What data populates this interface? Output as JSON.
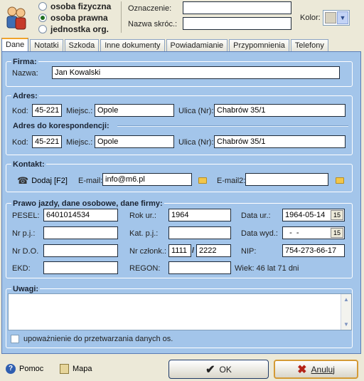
{
  "header": {
    "radio_options": [
      {
        "label": "osoba fizyczna",
        "selected": false
      },
      {
        "label": "osoba prawna",
        "selected": true
      },
      {
        "label": "jednostka org.",
        "selected": false
      }
    ],
    "oznaczenie_label": "Oznaczenie:",
    "oznaczenie_value": "",
    "nazwa_skroc_label": "Nazwa skróc.:",
    "nazwa_skroc_value": "",
    "kolor_label": "Kolor:"
  },
  "tabs": [
    "Dane",
    "Notatki",
    "Szkoda",
    "Inne dokumenty",
    "Powiadamianie",
    "Przypomnienia",
    "Telefony"
  ],
  "firma": {
    "title": "Firma:",
    "nazwa_label": "Nazwa:",
    "nazwa_value": "Jan Kowalski"
  },
  "adres": {
    "title": "Adres:",
    "kod_label": "Kod:",
    "kod_value": "45-221",
    "miejsc_label": "Miejsc.:",
    "miejsc_value": "Opole",
    "ulica_label": "Ulica (Nr):",
    "ulica_value": "Chabrów 35/1"
  },
  "adres_kor": {
    "title": "Adres do korespondencji:",
    "kod_label": "Kod:",
    "kod_value": "45-221",
    "miejsc_label": "Miejsc.:",
    "miejsc_value": "Opole",
    "ulica_label": "Ulica (Nr):",
    "ulica_value": "Chabrów 35/1"
  },
  "kontakt": {
    "title": "Kontakt:",
    "dodaj_label": "Dodaj [F2]",
    "email_label": "E-mail:",
    "email_value": "info@m6.pl",
    "email2_label": "E-mail2:",
    "email2_value": ""
  },
  "prawo": {
    "title": "Prawo jazdy, dane osobowe, dane firmy:",
    "pesel_label": "PESEL:",
    "pesel_value": "6401014534",
    "rok_label": "Rok ur.:",
    "rok_value": "1964",
    "data_ur_label": "Data ur.:",
    "data_ur_value": "1964-05-14",
    "nrpj_label": "Nr p.j.:",
    "nrpj_value": "",
    "katpj_label": "Kat. p.j.:",
    "katpj_value": "",
    "data_wyd_label": "Data wyd.:",
    "data_wyd_value": "  -  -",
    "nrdo_label": "Nr D.O.",
    "nrdo_value": "",
    "nrczl_label": "Nr członk.:",
    "nrczl_value1": "1111",
    "nrczl_sep": "/",
    "nrczl_value2": "2222",
    "nip_label": "NIP:",
    "nip_value": "754-273-66-17",
    "ekd_label": "EKD:",
    "ekd_value": "",
    "regon_label": "REGON:",
    "regon_value": "",
    "wiek_text": "Wiek: 46 lat 71 dni",
    "cal_glyph": "15"
  },
  "uwagi": {
    "title": "Uwagi:",
    "value": "",
    "consent_label": "upoważnienie do przetwarzania danych os.",
    "consent_checked": false
  },
  "footer": {
    "pomoc_label": "Pomoc",
    "mapa_label": "Mapa",
    "ok_label": "OK",
    "anuluj_label": "Anuluj"
  }
}
